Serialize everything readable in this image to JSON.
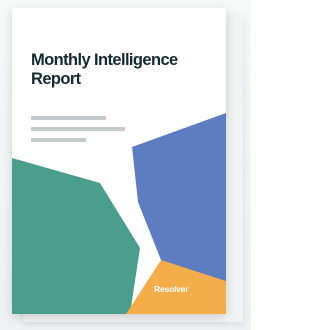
{
  "report": {
    "kicker": "",
    "title": "Monthly Intelligence Report"
  },
  "brand": {
    "name": "Resolver",
    "tagline": ""
  },
  "colors": {
    "teal": "#4b9d8c",
    "blue": "#5e7dc0",
    "orange": "#f3ad4b",
    "title_text": "#152a2e",
    "placeholder_lines": "#c3cccb"
  }
}
